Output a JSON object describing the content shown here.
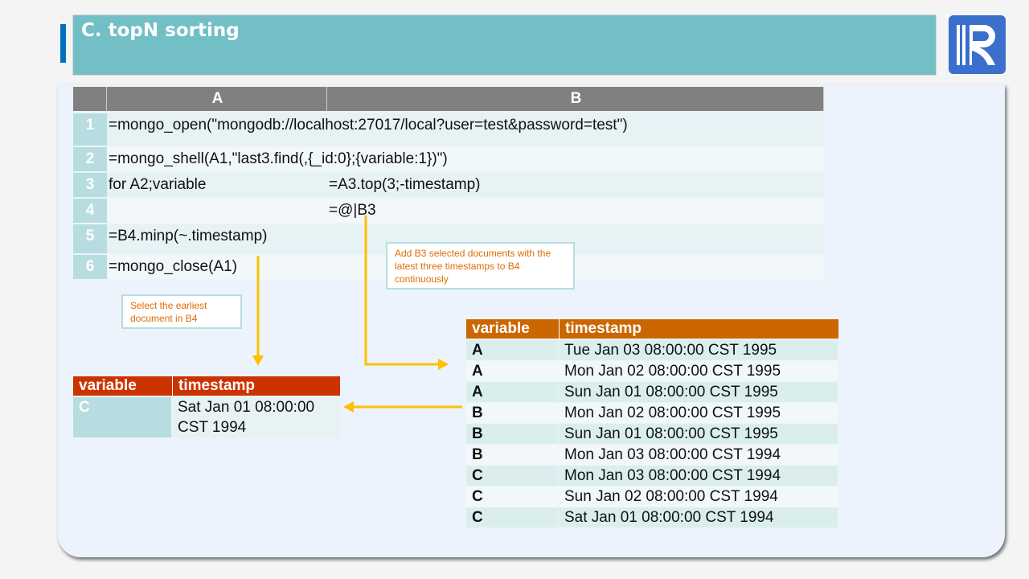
{
  "title": "C. topN sorting",
  "logo_text": "R",
  "grid": {
    "columns": [
      "A",
      "B"
    ],
    "rows": [
      {
        "num": "1",
        "a": "=mongo_open(\"mongodb://localhost:27017/local?user=test&password=test\")",
        "b": ""
      },
      {
        "num": "2",
        "a": "=mongo_shell(A1,\"last3.find(,{_id:0};{variable:1})\")",
        "b": ""
      },
      {
        "num": "3",
        "a": "for A2;variable",
        "b": "=A3.top(3;-timestamp)"
      },
      {
        "num": "4",
        "a": "",
        "b": "=@|B3"
      },
      {
        "num": "5",
        "a": "=B4.minp(~.timestamp)",
        "b": ""
      },
      {
        "num": "6",
        "a": "=mongo_close(A1)",
        "b": ""
      }
    ]
  },
  "callouts": {
    "b4": "Add B3 selected  documents with the latest three timestamps  to B4 continuously",
    "a5": "Select the earliest document in B4"
  },
  "result_table": {
    "headers": [
      "variable",
      "timestamp"
    ],
    "rows": [
      [
        "A",
        "Tue Jan 03 08:00:00 CST 1995"
      ],
      [
        "A",
        "Mon Jan 02 08:00:00 CST 1995"
      ],
      [
        "A",
        "Sun Jan 01 08:00:00 CST 1995"
      ],
      [
        "B",
        "Mon Jan 02 08:00:00 CST 1995"
      ],
      [
        "B",
        "Sun Jan 01 08:00:00 CST 1995"
      ],
      [
        "B",
        "Mon Jan 03 08:00:00 CST 1994"
      ],
      [
        "C",
        "Mon Jan 03 08:00:00 CST 1994"
      ],
      [
        "C",
        "Sun Jan 02 08:00:00 CST 1994"
      ],
      [
        "C",
        "Sat Jan 01 08:00:00 CST 1994"
      ]
    ]
  },
  "min_table": {
    "headers": [
      "variable",
      "timestamp"
    ],
    "row": [
      "C",
      "Sat Jan 01 08:00:00 CST 1994"
    ]
  },
  "colors": {
    "accent": "#72bfc6",
    "arrow": "#ffc000",
    "header_orange": "#cc6600",
    "header_red": "#cc3300"
  }
}
